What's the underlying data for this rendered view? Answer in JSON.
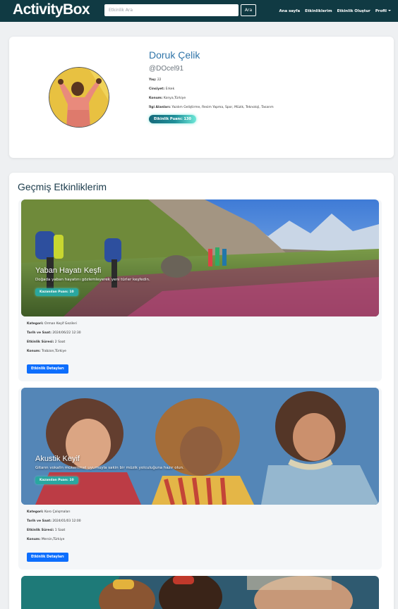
{
  "navbar": {
    "brand": "ActivityBox",
    "search_placeholder": "Etkinlik Ara",
    "search_button": "Ara",
    "links": [
      "Ana sayfa",
      "Etkinliklerim",
      "Etkinlik Oluştur",
      "Profil"
    ]
  },
  "profile": {
    "name": "Doruk Çelik",
    "username": "@DOcel91",
    "age_label": "Yaş:",
    "age": "22",
    "gender_label": "Cinsiyet:",
    "gender": "Erkek",
    "location_label": "Konum:",
    "location": "Konya,Türkiye",
    "interests_label": "İlgi Alanları:",
    "interests": "Yazılım Geliştirme, Resim Yapma, Spor, Müzik, Teknoloji, Tasarım",
    "points": "Etkinlik Puanı: 130"
  },
  "history": {
    "title": "Geçmiş Etkinliklerim",
    "labels": {
      "category": "Kategori:",
      "datetime": "Tarih ve Saat:",
      "duration": "Etkinlik Süresi:",
      "location": "Konum:"
    },
    "events": [
      {
        "title": "Yaban Hayatı Keşfi",
        "description": "Doğada yaban hayatını gözlemleyerek yeni türler keşfedin.",
        "points": "Kazanılan Puan: 10",
        "category": "Orman Keşif Gezileri",
        "datetime": "2024/06/22 12:30",
        "duration": "2 Saat",
        "location": "Trabzon,Türkiye",
        "button": "Etkinlik Detayları"
      },
      {
        "title": "Akustik Keyif",
        "description": "Gitarın vokalin mükemmel uyumuyla sakin bir müzik yolculuğuna hazır olun.",
        "points": "Kazanılan Puan: 10",
        "category": "Koro Çalışmaları",
        "datetime": "2024/01/03 12:00",
        "duration": "1 Saat",
        "location": "Mersin,Türkiye",
        "button": "Etkinlik Detayları"
      }
    ]
  }
}
